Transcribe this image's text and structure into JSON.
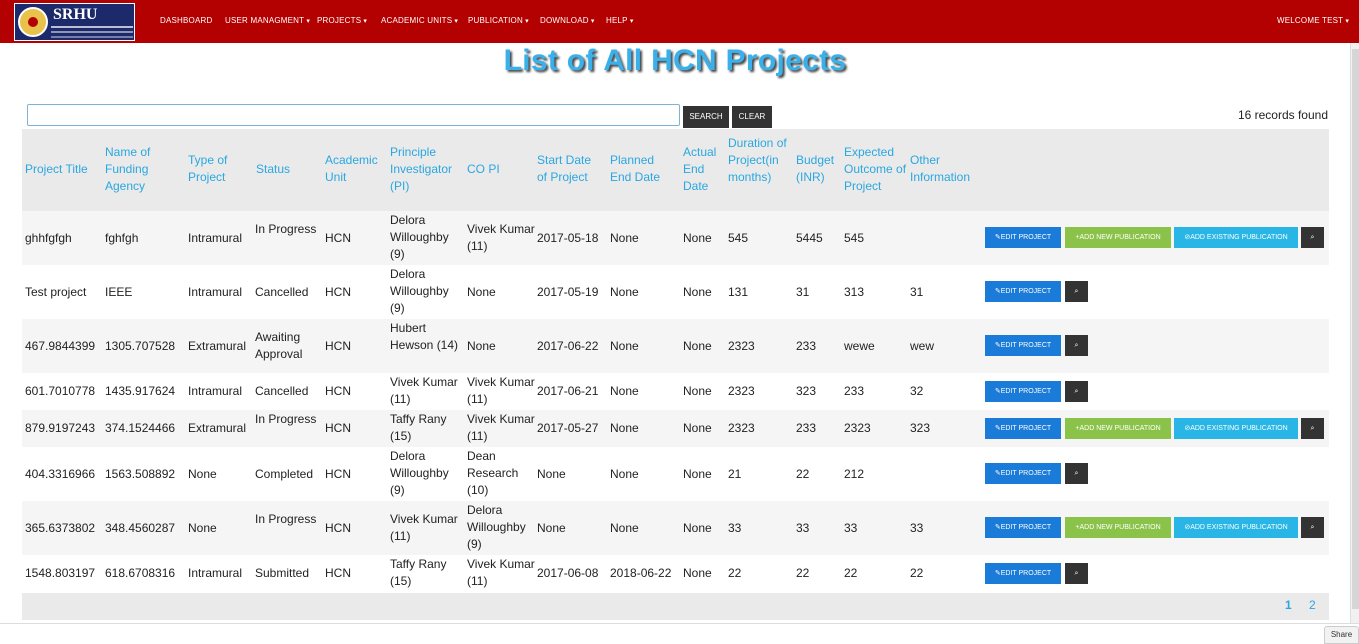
{
  "nav": {
    "logo_text": "SRHU",
    "menu": [
      "DASHBOARD",
      "USER MANAGMENT",
      "PROJECTS",
      "ACADEMIC UNITS",
      "PUBLICATION",
      "DOWNLOAD",
      "HELP"
    ],
    "welcome": "WELCOME TEST"
  },
  "page_title": "List of All HCN Projects",
  "search": {
    "value": "",
    "search_label": "SEARCH",
    "clear_label": "CLEAR"
  },
  "records": "16 records found",
  "columns": [
    "Project Title",
    "Name of Funding Agency",
    "Type of Project",
    "Status",
    "Academic Unit",
    "Principle Investigator (PI)",
    "CO PI",
    "Start Date of Project",
    "Planned End Date",
    "Actual End Date",
    "Duration of Project(in months)",
    "Budget (INR)",
    "Expected Outcome of Project",
    "Other Information"
  ],
  "buttons": {
    "edit": "EDIT PROJECT",
    "add_new": "ADD NEW PUBLICATION",
    "add_existing": "ADD EXISTING PUBLICATION"
  },
  "rows": [
    {
      "title": "ghhfgfgh",
      "agency": "fghfgh",
      "type": "Intramural",
      "status": "In Progress",
      "unit": "HCN",
      "pi": "Delora Willoughby (9)",
      "copi": "Vivek Kumar (11)",
      "start": "2017-05-18",
      "planned": "None",
      "actual": "None",
      "duration": "545",
      "budget": "5445",
      "outcome": "545",
      "other": "",
      "has_pub": true
    },
    {
      "title": "Test project",
      "agency": "IEEE",
      "type": "Intramural",
      "status": "Cancelled",
      "unit": "HCN",
      "pi": "Delora Willoughby (9)",
      "copi": "None",
      "start": "2017-05-19",
      "planned": "None",
      "actual": "None",
      "duration": "131",
      "budget": "31",
      "outcome": "313",
      "other": "31",
      "has_pub": false
    },
    {
      "title": "467.9844399",
      "agency": "1305.707528",
      "type": "Extramural",
      "status": "Awaiting Approval",
      "unit": "HCN",
      "pi": "Hubert Hewson (14)",
      "copi": "None",
      "start": "2017-06-22",
      "planned": "None",
      "actual": "None",
      "duration": "2323",
      "budget": "233",
      "outcome": "wewe",
      "other": "wew",
      "has_pub": false
    },
    {
      "title": "601.7010778",
      "agency": "1435.917624",
      "type": "Intramural",
      "status": "Cancelled",
      "unit": "HCN",
      "pi": "Vivek Kumar (11)",
      "copi": "Vivek Kumar (11)",
      "start": "2017-06-21",
      "planned": "None",
      "actual": "None",
      "duration": "2323",
      "budget": "323",
      "outcome": "233",
      "other": "32",
      "has_pub": false
    },
    {
      "title": "879.9197243",
      "agency": "374.1524466",
      "type": "Extramural",
      "status": "In Progress",
      "unit": "HCN",
      "pi": "Taffy Rany (15)",
      "copi": "Vivek Kumar (11)",
      "start": "2017-05-27",
      "planned": "None",
      "actual": "None",
      "duration": "2323",
      "budget": "233",
      "outcome": "2323",
      "other": "323",
      "has_pub": true
    },
    {
      "title": "404.3316966",
      "agency": "1563.508892",
      "type": "None",
      "status": "Completed",
      "unit": "HCN",
      "pi": "Delora Willoughby (9)",
      "copi": "Dean Research (10)",
      "start": "None",
      "planned": "None",
      "actual": "None",
      "duration": "21",
      "budget": "22",
      "outcome": "212",
      "other": "",
      "has_pub": false
    },
    {
      "title": "365.6373802",
      "agency": "348.4560287",
      "type": "None",
      "status": "In Progress",
      "unit": "HCN",
      "pi": "Vivek Kumar (11)",
      "copi": "Delora Willoughby (9)",
      "start": "None",
      "planned": "None",
      "actual": "None",
      "duration": "33",
      "budget": "33",
      "outcome": "33",
      "other": "33",
      "has_pub": true
    },
    {
      "title": "1548.803197",
      "agency": "618.6708316",
      "type": "Intramural",
      "status": "Submitted",
      "unit": "HCN",
      "pi": "Taffy Rany (15)",
      "copi": "Vivek Kumar (11)",
      "start": "2017-06-08",
      "planned": "2018-06-22",
      "actual": "None",
      "duration": "22",
      "budget": "22",
      "outcome": "22",
      "other": "22",
      "has_pub": false
    }
  ],
  "pagination": [
    "1",
    "2"
  ],
  "share": "Share"
}
